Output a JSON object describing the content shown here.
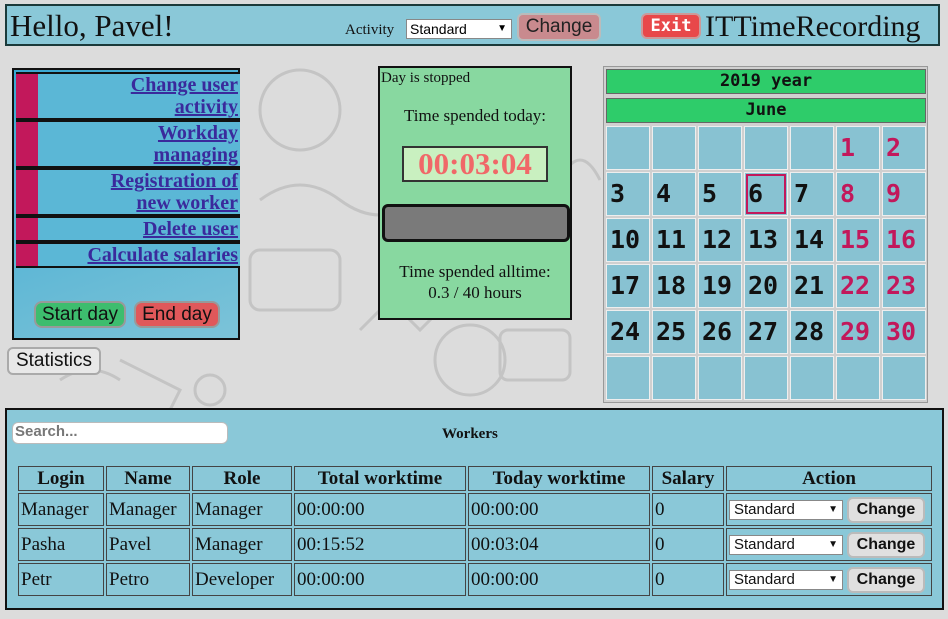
{
  "header": {
    "greeting": "Hello, Pavel!",
    "activity_label": "Activity",
    "activity_value": "Standard",
    "change_label": "Change",
    "exit_label": "Exit",
    "app_title": "ITTimeRecording"
  },
  "menu": {
    "items": [
      {
        "label_line1": "Change user",
        "label_line2": "activity"
      },
      {
        "label_line1": "Workday",
        "label_line2": "managing"
      },
      {
        "label_line1": "Registration of",
        "label_line2": "new worker"
      },
      {
        "label_line1": "Delete user"
      },
      {
        "label_line1": "Calculate salaries"
      }
    ],
    "start_label": "Start day",
    "end_label": "End day",
    "statistics_label": "Statistics"
  },
  "timer": {
    "status": "Day is stopped",
    "today_label": "Time spended today:",
    "today_value": "00:03:04",
    "progress_fraction": 0,
    "alltime_label": "Time spended alltime:",
    "alltime_value": "0.3 / 40 hours"
  },
  "calendar": {
    "year_label": "2019 year",
    "month_label": "June",
    "today": 6,
    "cells": [
      "",
      "",
      "",
      "",
      "",
      "1",
      "2",
      "3",
      "4",
      "5",
      "6",
      "7",
      "8",
      "9",
      "10",
      "11",
      "12",
      "13",
      "14",
      "15",
      "16",
      "17",
      "18",
      "19",
      "20",
      "21",
      "22",
      "23",
      "24",
      "25",
      "26",
      "27",
      "28",
      "29",
      "30",
      "",
      "",
      "",
      "",
      "",
      "",
      ""
    ]
  },
  "workers": {
    "search_placeholder": "Search...",
    "title": "Workers",
    "columns": [
      "Login",
      "Name",
      "Role",
      "Total worktime",
      "Today worktime",
      "Salary",
      "Action"
    ],
    "rows": [
      {
        "login": "Manager",
        "name": "Manager",
        "role": "Manager",
        "total": "00:00:00",
        "today": "00:00:00",
        "salary": "0",
        "activity": "Standard",
        "action": "Change"
      },
      {
        "login": "Pasha",
        "name": "Pavel",
        "role": "Manager",
        "total": "00:15:52",
        "today": "00:03:04",
        "salary": "0",
        "activity": "Standard",
        "action": "Change"
      },
      {
        "login": "Petr",
        "name": "Petro",
        "role": "Developer",
        "total": "00:00:00",
        "today": "00:00:00",
        "salary": "0",
        "activity": "Standard",
        "action": "Change"
      }
    ]
  },
  "colors": {
    "panel_blue": "#8ac8d8",
    "accent_green": "#2ecc6a",
    "weekend_pink": "#c2185b",
    "clock_red": "#f06868",
    "menu_bar": "#c2185b"
  }
}
